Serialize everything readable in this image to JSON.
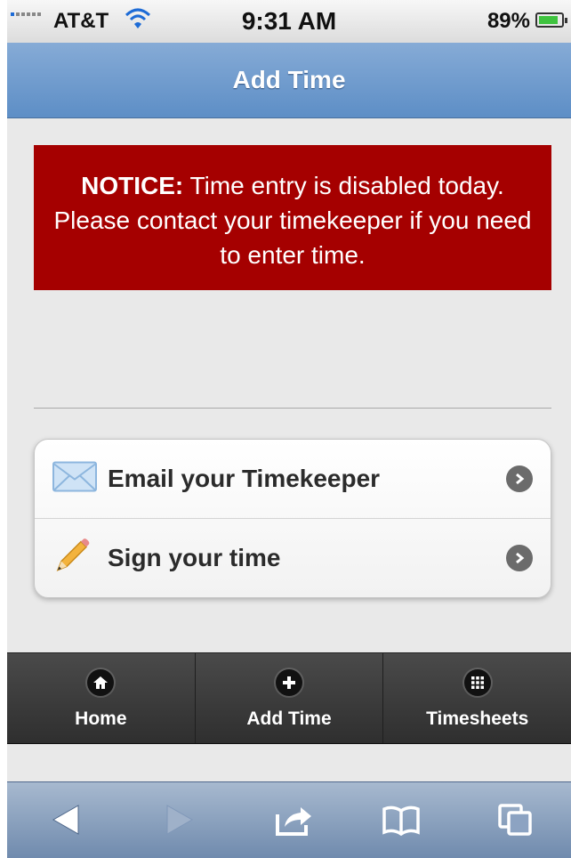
{
  "status_bar": {
    "carrier": "AT&T",
    "time": "9:31 AM",
    "battery": "89%",
    "battery_fraction": 0.89,
    "icons": [
      "signal-icon",
      "wifi-icon",
      "battery-icon"
    ]
  },
  "header": {
    "title": "Add Time"
  },
  "notice": {
    "prefix": "NOTICE:",
    "message": "Time entry is disabled today. Please contact your timekeeper if you need to enter time.",
    "background": "#a50000"
  },
  "list": {
    "items": [
      {
        "label": "Email your Timekeeper",
        "icon": "envelope-icon"
      },
      {
        "label": "Sign your time",
        "icon": "pencil-icon"
      }
    ]
  },
  "tabbar": {
    "tabs": [
      {
        "label": "Home",
        "icon": "home-icon"
      },
      {
        "label": "Add Time",
        "icon": "plus-icon"
      },
      {
        "label": "Timesheets",
        "icon": "grid-icon"
      }
    ]
  },
  "browser_toolbar": {
    "buttons": [
      "back-icon",
      "forward-icon",
      "share-icon",
      "bookmarks-icon",
      "tabs-icon"
    ]
  },
  "colors": {
    "header_blue": "#6b97cc",
    "notice_red": "#a50000",
    "tabbar_dark": "#3a3a3a",
    "toolbar_blue": "#8ca3c2"
  }
}
